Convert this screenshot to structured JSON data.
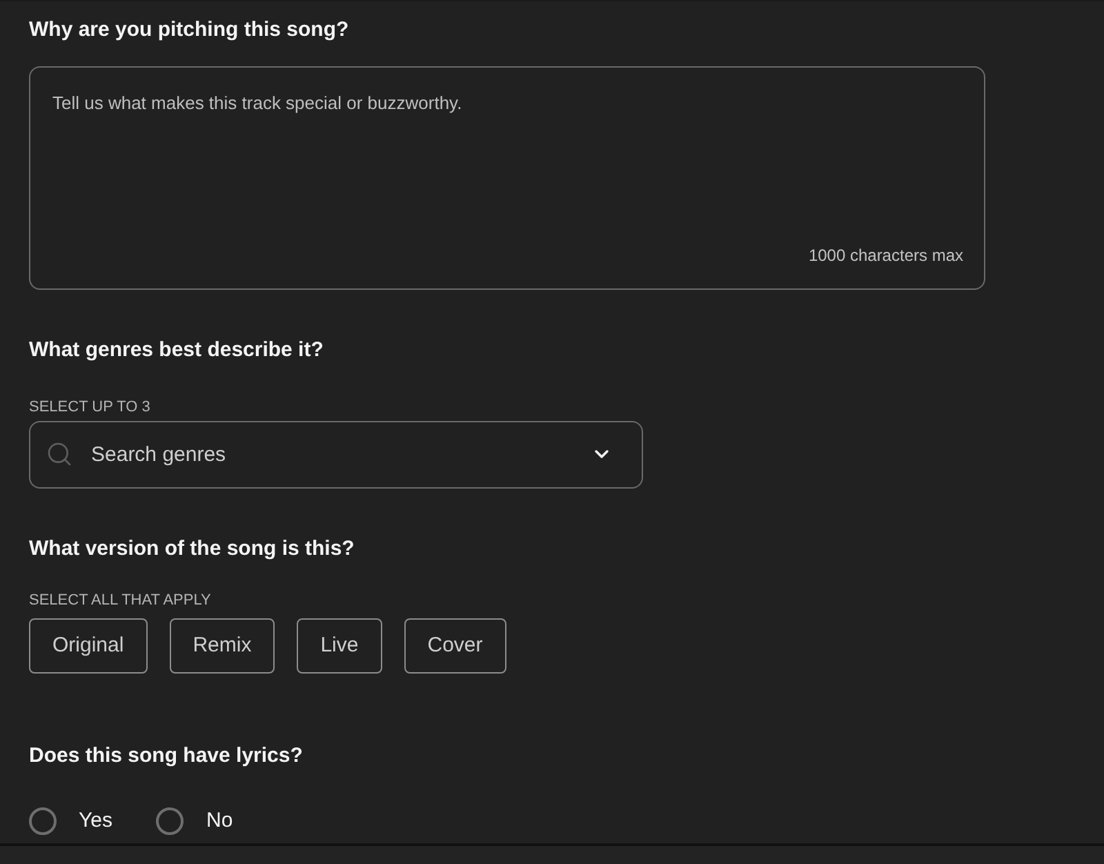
{
  "pitch": {
    "heading": "Why are you pitching this song?",
    "placeholder": "Tell us what makes this track special or buzzworthy.",
    "counter": "1000 characters max"
  },
  "genres": {
    "heading": "What genres best describe it?",
    "hint": "SELECT UP TO 3",
    "placeholder": "Search genres"
  },
  "version": {
    "heading": "What version of the song is this?",
    "hint": "SELECT ALL THAT APPLY",
    "options": [
      {
        "label": "Original",
        "selected": false
      },
      {
        "label": "Remix",
        "selected": false
      },
      {
        "label": "Live",
        "selected": false
      },
      {
        "label": "Cover",
        "selected": false
      }
    ]
  },
  "lyrics": {
    "heading": "Does this song have lyrics?",
    "options": [
      {
        "label": "Yes",
        "selected": false
      },
      {
        "label": "No",
        "selected": false
      }
    ]
  }
}
